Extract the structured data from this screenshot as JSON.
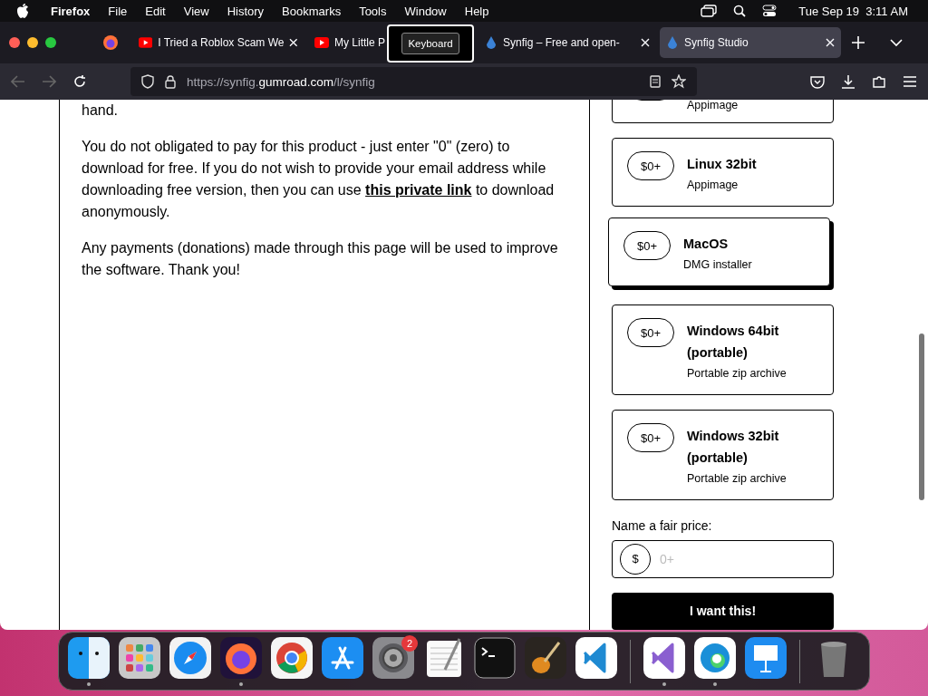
{
  "menu_bar": {
    "app": "Firefox",
    "items": [
      "File",
      "Edit",
      "View",
      "History",
      "Bookmarks",
      "Tools",
      "Window",
      "Help"
    ],
    "clock": "Tue Sep 19  3:11 AM"
  },
  "tabs": [
    {
      "kind": "pinned",
      "selected": false
    },
    {
      "kind": "video",
      "label": "I Tried a Roblox Scam We",
      "selected": false,
      "closable": true
    },
    {
      "kind": "video",
      "label": "My Little P",
      "selected": false
    },
    {
      "kind": "site",
      "label": "Synfig – Free and open-",
      "selected": false,
      "closable": true
    },
    {
      "kind": "site",
      "label": "Synfig Studio",
      "selected": true,
      "closable": true
    }
  ],
  "keyboard_popup": {
    "label": "Keyboard"
  },
  "address_bar": {
    "prefix": "https://synfig.",
    "domain": "gumroad.com",
    "suffix": "/l/synfig"
  },
  "description": {
    "fragment": "hand.",
    "paragraphs": [
      {
        "before": "You do not obligated to pay for this product - just enter \"0\" (zero) to download for free. If you do not wish to provide your email address while downloading free version, then you can use ",
        "link": "this private link",
        "after": " to download anonymously."
      },
      {
        "before": "Any payments (donations) made through this page will be used to improve the software. Thank you!"
      }
    ]
  },
  "versions": [
    {
      "kind": "partial",
      "subtitle": "Appimage",
      "selected": false
    },
    {
      "kind": "full",
      "price": "$0+",
      "title": "Linux 32bit",
      "subtitle": "Appimage",
      "selected": false
    },
    {
      "kind": "full",
      "price": "$0+",
      "title": "MacOS",
      "subtitle": "DMG installer",
      "selected": true
    },
    {
      "kind": "full",
      "price": "$0+",
      "title": "Windows 64bit (portable)",
      "subtitle": "Portable zip archive",
      "selected": false
    },
    {
      "kind": "full",
      "price": "$0+",
      "title": "Windows 32bit (portable)",
      "subtitle": "Portable zip archive",
      "selected": false
    }
  ],
  "price_field": {
    "label": "Name a fair price:",
    "currency": "$",
    "placeholder": "0+"
  },
  "buy_button": "I want this!",
  "dock": [
    {
      "kind": "finder",
      "running": true
    },
    {
      "kind": "launchpad",
      "running": false
    },
    {
      "kind": "safari",
      "running": false
    },
    {
      "kind": "firefox",
      "running": true
    },
    {
      "kind": "chrome",
      "running": false
    },
    {
      "kind": "appstore",
      "running": false
    },
    {
      "kind": "settings",
      "running": false,
      "badge": "2"
    },
    {
      "kind": "textedit",
      "running": false
    },
    {
      "kind": "terminal",
      "running": false
    },
    {
      "kind": "garageband",
      "running": false
    },
    {
      "kind": "vscode",
      "running": false
    },
    {
      "kind": "separator"
    },
    {
      "kind": "visualstudio",
      "running": true
    },
    {
      "kind": "edge",
      "running": true
    },
    {
      "kind": "keynote",
      "running": false
    },
    {
      "kind": "separator"
    },
    {
      "kind": "trash",
      "running": false
    }
  ]
}
